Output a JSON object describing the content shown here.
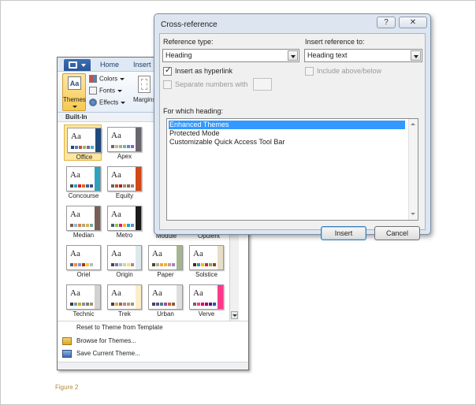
{
  "word": {
    "tabs": [
      "Home",
      "Insert"
    ],
    "ribbon": {
      "themes_label": "Themes",
      "themes_icon_text": "Aa",
      "colors_label": "Colors",
      "fonts_label": "Fonts",
      "effects_label": "Effects",
      "margins_label": "Margins"
    },
    "gallery": {
      "section_label": "Built-In",
      "thumb_text": "Aa",
      "themes": [
        {
          "name": "Office",
          "colors": [
            "#1f497d",
            "#4f81bd",
            "#c0504d",
            "#9bbb59",
            "#8064a2",
            "#4bacc6"
          ],
          "side": "#1f497d",
          "selected": true
        },
        {
          "name": "Apex",
          "colors": [
            "#69676d",
            "#ceb966",
            "#9cb084",
            "#6bb1c9",
            "#6585cf",
            "#7e6bc9"
          ],
          "side": "#69676d"
        },
        {
          "name": "Concourse",
          "colors": [
            "#464646",
            "#2da2bf",
            "#da1f28",
            "#eb641b",
            "#39639d",
            "#474b78"
          ],
          "side": "#2da2bf"
        },
        {
          "name": "Equity",
          "colors": [
            "#696464",
            "#d34817",
            "#9b2d1f",
            "#a28e6a",
            "#956251",
            "#918485"
          ],
          "side": "#d34817"
        },
        {
          "name": "Median",
          "colors": [
            "#775f55",
            "#94b6d2",
            "#dd8047",
            "#a5ab81",
            "#d8b25c",
            "#7ba79d"
          ],
          "side": "#775f55"
        },
        {
          "name": "Metro",
          "colors": [
            "#4e5b6f",
            "#7fd13b",
            "#ea157a",
            "#feb80a",
            "#00addc",
            "#738ac8"
          ],
          "side": "#1b1b1b"
        },
        {
          "name": "Oriel",
          "colors": [
            "#575f6d",
            "#fe8637",
            "#7598d9",
            "#b32c16",
            "#f5cd2d",
            "#aebad5"
          ],
          "side": "#ffffff"
        },
        {
          "name": "Origin",
          "colors": [
            "#464653",
            "#727ca3",
            "#9fb8cd",
            "#d2da7a",
            "#fada7a",
            "#b88472"
          ],
          "side": "#dde9ec"
        },
        {
          "name": "Paper",
          "colors": [
            "#444d26",
            "#a5b592",
            "#f3a447",
            "#e7bc29",
            "#d092a7",
            "#9c85c0"
          ],
          "side": "#a5b592"
        },
        {
          "name": "Solstice",
          "colors": [
            "#4f271c",
            "#3891a7",
            "#feb80a",
            "#c32d2e",
            "#84aa33",
            "#964305"
          ],
          "side": "#e7dec9"
        },
        {
          "name": "Technic",
          "colors": [
            "#3b3b3b",
            "#6ea0b0",
            "#ccaf0a",
            "#8d89a4",
            "#748560",
            "#9e9273"
          ],
          "side": "#d4d2d0"
        },
        {
          "name": "Trek",
          "colors": [
            "#4e3b30",
            "#f0a22e",
            "#a5644e",
            "#b58b80",
            "#c3986d",
            "#a19574"
          ],
          "side": "#fbeec9"
        },
        {
          "name": "Urban",
          "colors": [
            "#424456",
            "#53548a",
            "#438086",
            "#a04da3",
            "#c4652d",
            "#8b5d3d"
          ],
          "side": "#dedede"
        },
        {
          "name": "Verve",
          "colors": [
            "#666666",
            "#ff388c",
            "#e40059",
            "#9c007f",
            "#68007f",
            "#005bd3"
          ],
          "side": "#ff388c"
        }
      ],
      "cut_labels": [
        "Module",
        "Opulent"
      ],
      "menu": [
        {
          "label": "Reset to Theme from Template",
          "icon": "reset-icon"
        },
        {
          "label": "Browse for Themes...",
          "icon": "browse-icon"
        },
        {
          "label": "Save Current Theme...",
          "icon": "save-icon"
        }
      ]
    }
  },
  "figure_caption": "Figure 2",
  "dialog": {
    "title": "Cross-reference",
    "help_glyph": "?",
    "close_glyph": "✕",
    "reference_type_label": "Reference type:",
    "reference_type_value": "Heading",
    "insert_reference_label": "Insert reference to:",
    "insert_reference_value": "Heading text",
    "insert_hyperlink_label": "Insert as hyperlink",
    "insert_hyperlink_checked": true,
    "include_above_below_label": "Include above/below",
    "separate_numbers_label": "Separate numbers with",
    "for_which_label": "For which heading:",
    "headings": [
      "Enhanced Themes",
      "Protected Mode",
      "Customizable Quick Access Tool Bar"
    ],
    "selected_heading": 0,
    "insert_button": "Insert",
    "cancel_button": "Cancel"
  }
}
